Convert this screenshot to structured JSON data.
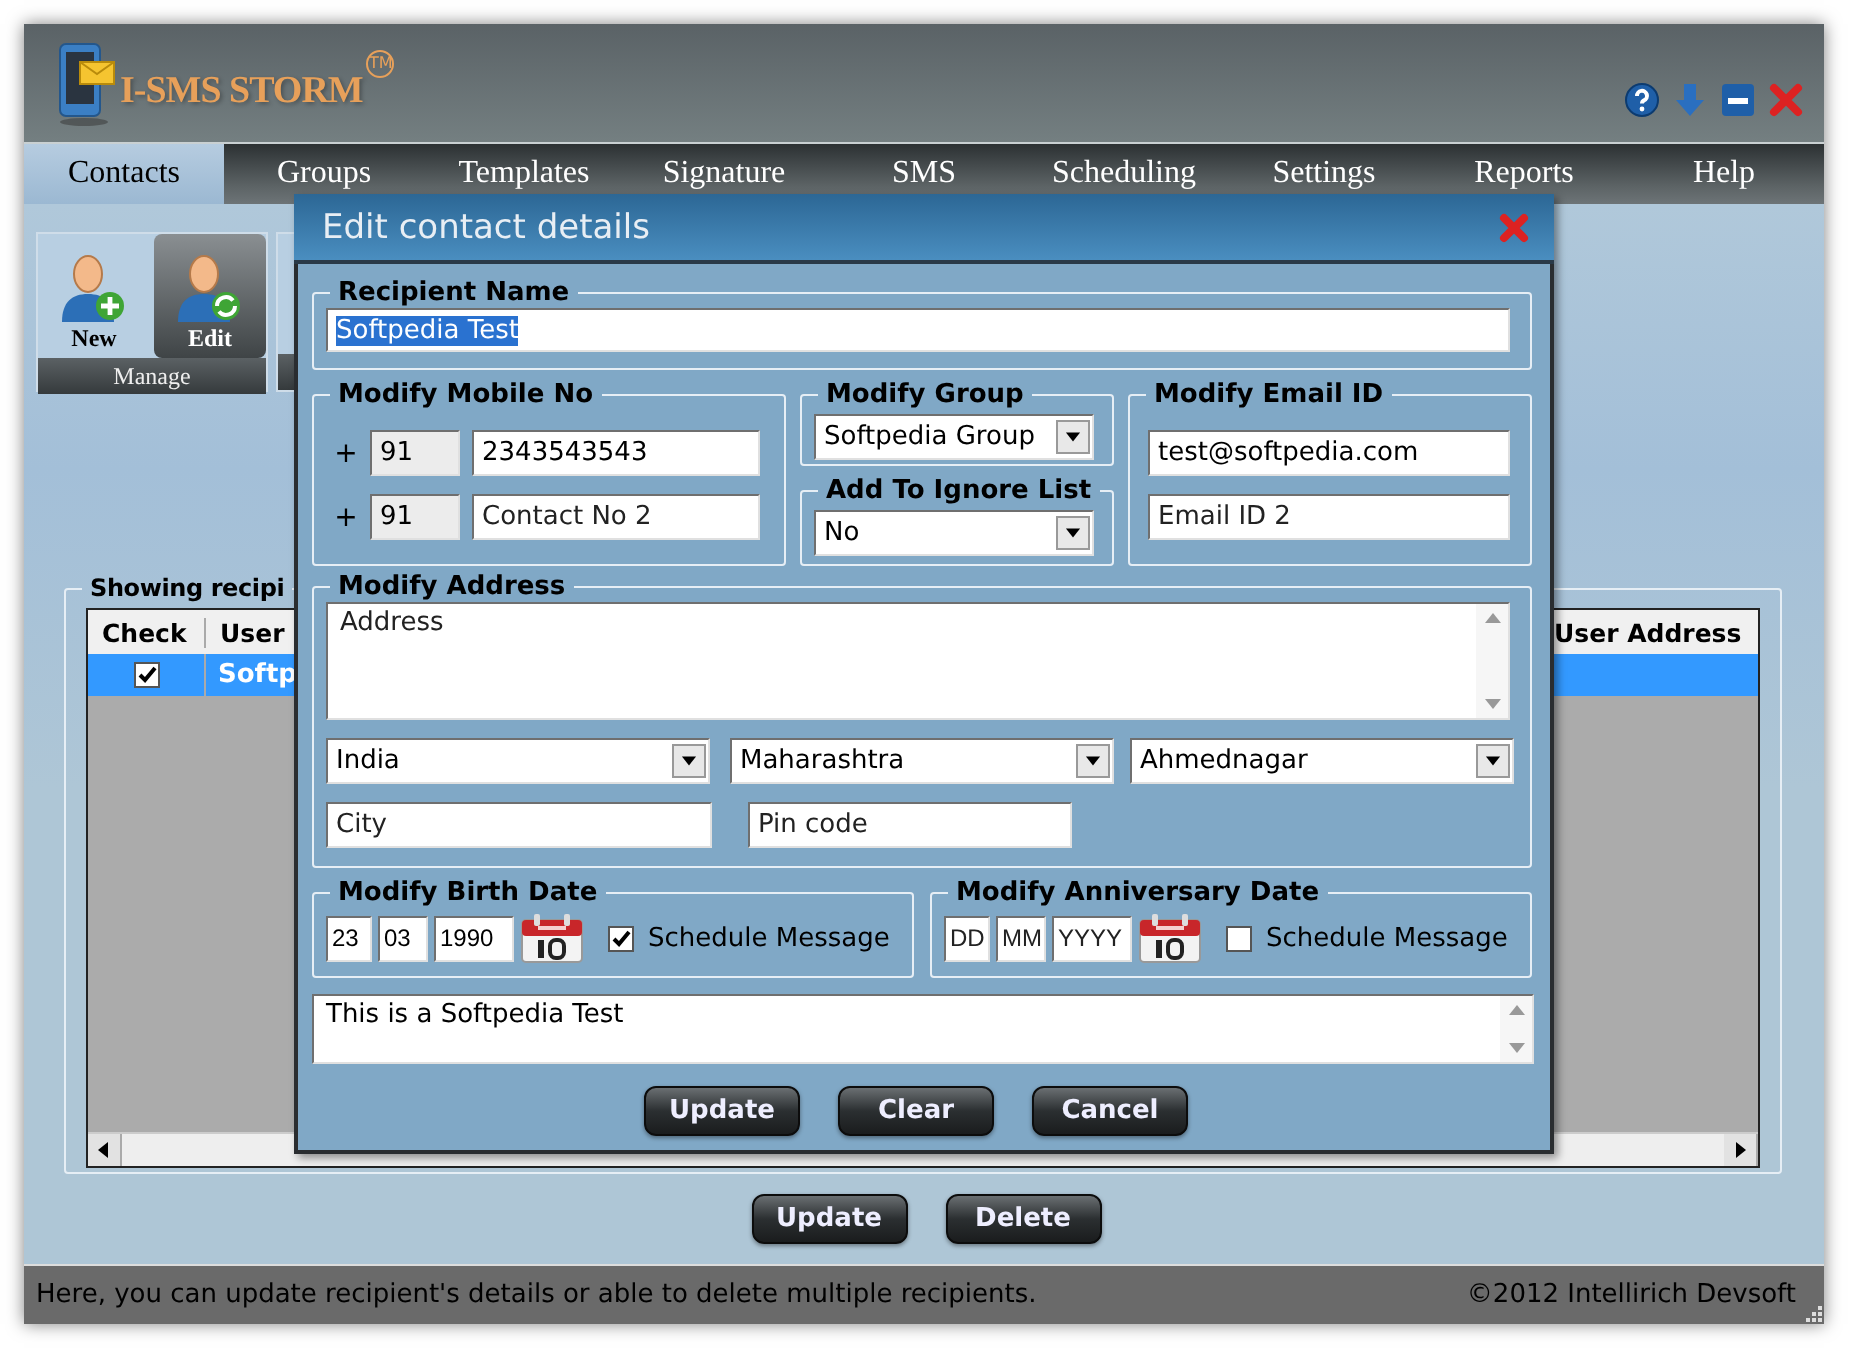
{
  "app": {
    "logo_text": "I-SMS STORM",
    "trademark": "TM"
  },
  "nav_tabs": [
    {
      "label": "Contacts",
      "selected": true
    },
    {
      "label": "Groups",
      "selected": false
    },
    {
      "label": "Templates",
      "selected": false
    },
    {
      "label": "Signature",
      "selected": false
    },
    {
      "label": "SMS",
      "selected": false
    },
    {
      "label": "Scheduling",
      "selected": false
    },
    {
      "label": "Settings",
      "selected": false
    },
    {
      "label": "Reports",
      "selected": false
    },
    {
      "label": "Help",
      "selected": false
    }
  ],
  "ribbon": {
    "buttons": [
      {
        "label": "New",
        "kind": "add",
        "selected": false
      },
      {
        "label": "Edit",
        "kind": "edit",
        "selected": true
      }
    ],
    "group_label": "Manage"
  },
  "recipients": {
    "title": "Showing recipi",
    "columns": [
      "Check",
      "User",
      "User Address"
    ],
    "rows": [
      {
        "checked": true,
        "selected": true,
        "user": "Softp"
      }
    ]
  },
  "actions": [
    "Update",
    "Delete"
  ],
  "status_bar": {
    "message": "Here, you can update recipient's details or able to delete multiple recipients.",
    "copyright": "©2012 Intellirich Devsoft"
  },
  "dialog": {
    "title": "Edit contact details",
    "recipient_name": {
      "label": "Recipient Name",
      "value": "Softpedia Test",
      "selected": true
    },
    "mobile": {
      "label": "Modify Mobile No",
      "numbers": [
        {
          "prefix": "+",
          "code": "91",
          "value": "2343543543"
        },
        {
          "prefix": "+",
          "code": "91",
          "placeholder": "Contact No 2"
        }
      ]
    },
    "group": {
      "label": "Modify Group",
      "value": "Softpedia Group"
    },
    "ignore_list": {
      "label": "Add To Ignore List",
      "value": "No"
    },
    "email": {
      "label": "Modify Email ID",
      "fields": [
        {
          "value": "test@softpedia.com"
        },
        {
          "placeholder": "Email ID 2"
        }
      ]
    },
    "address": {
      "label": "Modify Address",
      "placeholder": "Address",
      "country": "India",
      "state": "Maharashtra",
      "district": "Ahmednagar",
      "city_placeholder": "City",
      "pin_placeholder": "Pin code"
    },
    "dates": [
      {
        "label": "Modify Birth Date",
        "day": {
          "value": "23"
        },
        "month": {
          "value": "03"
        },
        "year": {
          "value": "1990"
        },
        "schedule_label": "Schedule Message",
        "checked": true
      },
      {
        "label": "Modify Anniversary Date",
        "day": {
          "placeholder": "DD"
        },
        "month": {
          "placeholder": "MM"
        },
        "year": {
          "placeholder": "YYYY"
        },
        "schedule_label": "Schedule Message",
        "checked": false
      }
    ],
    "note": "This is a Softpedia Test",
    "buttons": [
      "Update",
      "Clear",
      "Cancel"
    ]
  }
}
